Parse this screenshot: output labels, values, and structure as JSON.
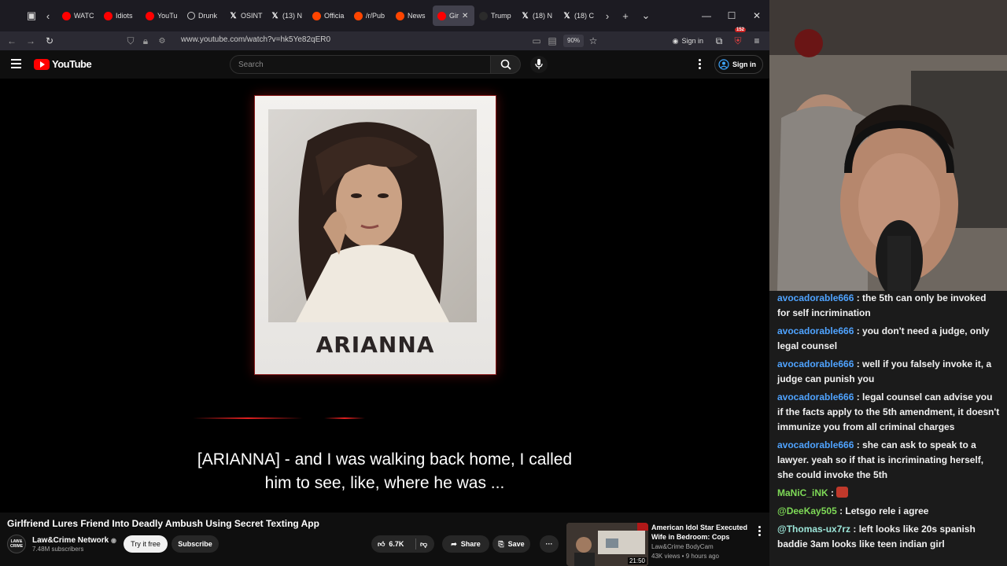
{
  "browser": {
    "tabs": [
      {
        "label": "WATC",
        "icon": "youtube-favicon"
      },
      {
        "label": "Idiots",
        "icon": "youtube-favicon"
      },
      {
        "label": "YouTu",
        "icon": "youtube-favicon"
      },
      {
        "label": "Drunk",
        "icon": "generic-favicon"
      },
      {
        "label": "OSINT",
        "icon": "x-favicon"
      },
      {
        "label": "(13) N",
        "icon": "x-favicon"
      },
      {
        "label": "Officia",
        "icon": "reddit-favicon"
      },
      {
        "label": "/r/Pub",
        "icon": "reddit-favicon"
      },
      {
        "label": "News",
        "icon": "reddit-favicon"
      },
      {
        "label": "Gir",
        "icon": "youtube-favicon",
        "active": true
      },
      {
        "label": "Trump",
        "icon": "dark-favicon"
      },
      {
        "label": "(18) N",
        "icon": "x-favicon"
      },
      {
        "label": "(18) C",
        "icon": "x-favicon"
      }
    ],
    "url": "www.youtube.com/watch?v=hk5Ye82qER0",
    "zoom": "90%",
    "signin_label": "Sign in",
    "extension_badge": "152"
  },
  "youtube": {
    "logo_text": "YouTube",
    "search_placeholder": "Search",
    "signin_label": "Sign in",
    "video": {
      "polaroid_name": "ARIANNA",
      "caption_line1": "[ARIANNA] - and I was walking back home, I called",
      "caption_line2": "him to see, like, where he was ..."
    },
    "title": "Girlfriend Lures Friend Into Deadly Ambush Using Secret Texting App",
    "channel": {
      "avatar_text": "LAW& CRIME",
      "name": "Law&Crime Network",
      "subscribers": "7.48M subscribers",
      "try_label": "Try it free",
      "subscribe_label": "Subscribe"
    },
    "actions": {
      "likes": "6.7K",
      "share_label": "Share",
      "save_label": "Save"
    },
    "suggested": {
      "title": "American Idol Star Executed Wife in Bedroom: Cops",
      "channel": "Law&Crime BodyCam",
      "meta": "43K views • 9 hours ago",
      "duration": "21:50"
    }
  },
  "chat": [
    {
      "user": "avocadorable666",
      "color": "blue",
      "text": " : the 5th can only be invoked for self incrimination"
    },
    {
      "user": "avocadorable666",
      "color": "blue",
      "text": " : you don't need a judge, only legal counsel"
    },
    {
      "user": "avocadorable666",
      "color": "blue",
      "text": " : well if you falsely invoke it, a judge can punish you"
    },
    {
      "user": "avocadorable666",
      "color": "blue",
      "text": " : legal counsel can advise you if the facts apply to the 5th amendment, it doesn't immunize you from all criminal charges"
    },
    {
      "user": "avocadorable666",
      "color": "blue",
      "text": " : she can ask to speak to a lawyer. yeah so if that is incriminating herself, she could invoke the 5th"
    },
    {
      "user": "MaNiC_iNK",
      "color": "green",
      "text": " : ",
      "emote": true
    },
    {
      "user": "@DeeKay505",
      "color": "green",
      "text": " : Letsgo rele i agree"
    },
    {
      "user": "@Thomas-ux7rz",
      "color": "teal",
      "text": " : left looks like 20s spanish baddie 3am looks like teen indian girl"
    }
  ]
}
